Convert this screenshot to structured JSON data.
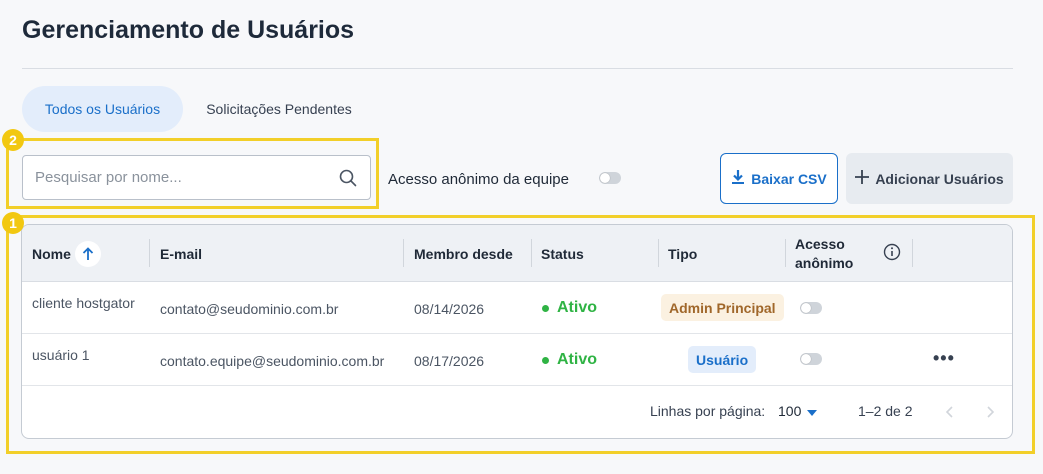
{
  "page": {
    "title": "Gerenciamento de Usuários"
  },
  "tabs": [
    {
      "label": "Todos os Usuários",
      "active": true
    },
    {
      "label": "Solicitações Pendentes",
      "active": false
    }
  ],
  "markers": {
    "one": "1",
    "two": "2"
  },
  "search": {
    "placeholder": "Pesquisar por nome...",
    "value": ""
  },
  "team_anonymous": {
    "label": "Acesso anônimo da equipe",
    "enabled": false
  },
  "toolbar": {
    "csv_label": "Baixar CSV",
    "add_label": "Adicionar Usuários"
  },
  "table": {
    "headers": {
      "name": "Nome",
      "email": "E-mail",
      "member_since": "Membro desde",
      "status": "Status",
      "type": "Tipo",
      "anon_line1": "Acesso",
      "anon_line2": "anônimo"
    },
    "rows": [
      {
        "name": "cliente hostgator",
        "email": "contato@seudominio.com.br",
        "member_since": "08/14/2026",
        "status": "Ativo",
        "type": "Admin Principal",
        "anon": false
      },
      {
        "name": "usuário 1",
        "email": "contato.equipe@seudominio.com.br",
        "member_since": "08/17/2026",
        "status": "Ativo",
        "type": "Usuário",
        "anon": false,
        "more": "•••"
      }
    ],
    "footer": {
      "rows_label": "Linhas por página:",
      "rows_value": "100",
      "range": "1–2 de 2"
    }
  },
  "colors": {
    "accent": "#1a6fc9",
    "active": "#2fb344",
    "highlight": "#f2cf29"
  }
}
